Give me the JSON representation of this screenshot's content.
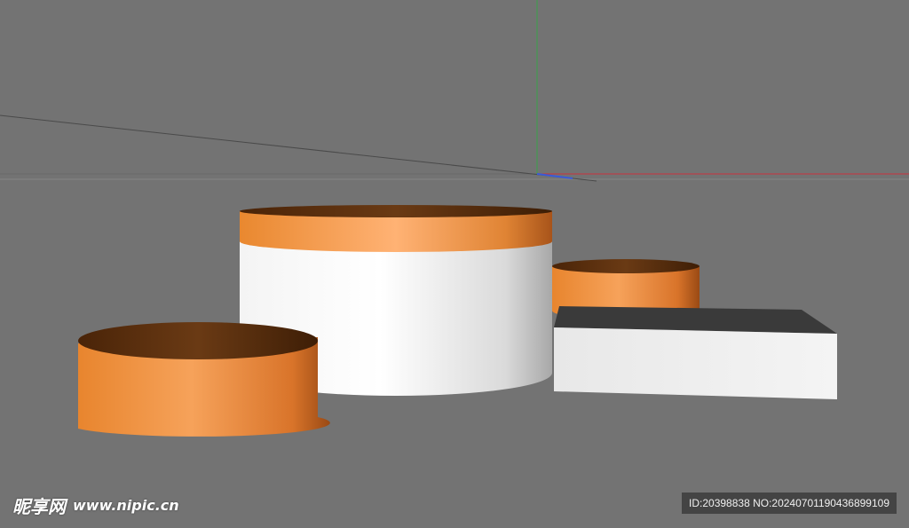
{
  "viewport": {
    "background_color": "#737373",
    "axes": {
      "x_axis_color": "#c8323c",
      "y_axis_color": "#3aa04a",
      "z_axis_color": "#3a5ad8",
      "horizon_line_color": "#5a5a5a"
    },
    "objects": [
      {
        "name": "large-white-cylinder",
        "body_color": "#f2f2f2",
        "band_color": "#f0913a",
        "top_color": "#5a300f"
      },
      {
        "name": "small-orange-cylinder-left",
        "body_color": "#f0913a",
        "top_color": "#5a300f"
      },
      {
        "name": "small-orange-cylinder-back-right",
        "body_color": "#f0913a",
        "top_color": "#5a300f"
      },
      {
        "name": "white-box-right",
        "face_color": "#f0f0f0",
        "top_color": "#3a3a3a"
      }
    ]
  },
  "watermark": {
    "brand": "昵享网",
    "url": "www.nipic.cn",
    "id_text": "ID:20398838 NO:20240701190436899109"
  }
}
